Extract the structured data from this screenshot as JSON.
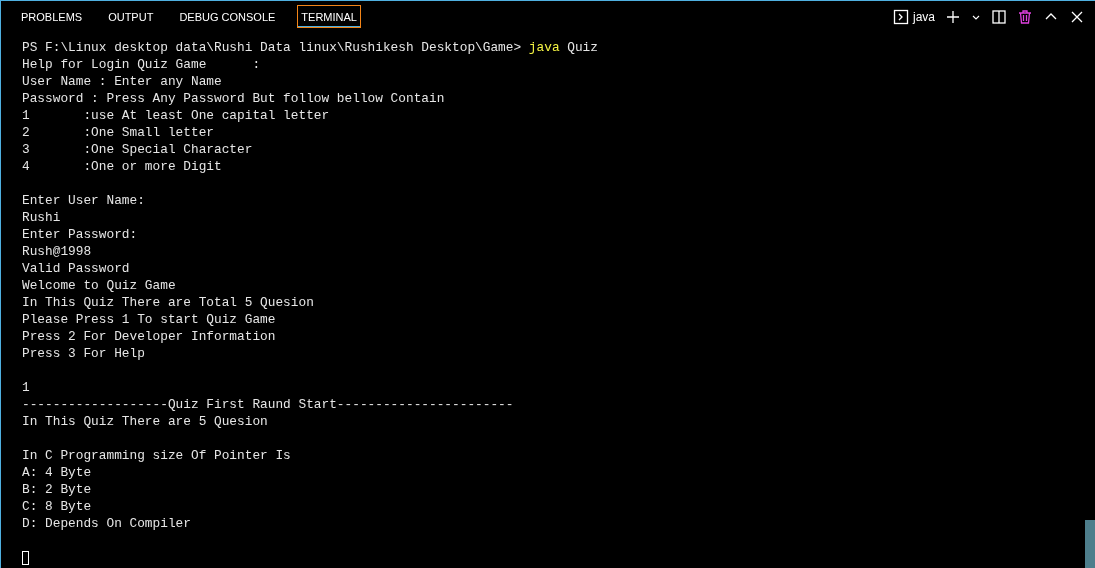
{
  "tabs": [
    {
      "label": "PROBLEMS",
      "selected": false
    },
    {
      "label": "OUTPUT",
      "selected": false
    },
    {
      "label": "DEBUG CONSOLE",
      "selected": false
    },
    {
      "label": "TERMINAL",
      "selected": true
    }
  ],
  "terminal_picker": {
    "label": "java"
  },
  "lines": [
    {
      "kind": "command",
      "prompt": "PS F:\\Linux desktop data\\Rushi Data linux\\Rushikesh Desktop\\Game>",
      "command": "java",
      "args": "Quiz"
    },
    {
      "kind": "text",
      "text": "Help for Login Quiz Game      :"
    },
    {
      "kind": "text",
      "text": "User Name : Enter any Name"
    },
    {
      "kind": "text",
      "text": "Password : Press Any Password But follow bellow Contain"
    },
    {
      "kind": "text",
      "text": "1       :use At least One capital letter"
    },
    {
      "kind": "text",
      "text": "2       :One Small letter"
    },
    {
      "kind": "text",
      "text": "3       :One Special Character"
    },
    {
      "kind": "text",
      "text": "4       :One or more Digit"
    },
    {
      "kind": "blank"
    },
    {
      "kind": "text",
      "text": "Enter User Name:"
    },
    {
      "kind": "text",
      "text": "Rushi"
    },
    {
      "kind": "text",
      "text": "Enter Password:"
    },
    {
      "kind": "text",
      "text": "Rush@1998"
    },
    {
      "kind": "text",
      "text": "Valid Password"
    },
    {
      "kind": "text",
      "text": "Welcome to Quiz Game"
    },
    {
      "kind": "text",
      "text": "In This Quiz There are Total 5 Quesion"
    },
    {
      "kind": "text",
      "text": "Please Press 1 To start Quiz Game"
    },
    {
      "kind": "text",
      "text": "Press 2 For Developer Information"
    },
    {
      "kind": "text",
      "text": "Press 3 For Help"
    },
    {
      "kind": "blank"
    },
    {
      "kind": "text",
      "text": "1"
    },
    {
      "kind": "text",
      "text": "-------------------Quiz First Raund Start-----------------------"
    },
    {
      "kind": "text",
      "text": "In This Quiz There are 5 Quesion"
    },
    {
      "kind": "blank"
    },
    {
      "kind": "text",
      "text": "In C Programming size Of Pointer Is"
    },
    {
      "kind": "text",
      "text": "A: 4 Byte"
    },
    {
      "kind": "text",
      "text": "B: 2 Byte"
    },
    {
      "kind": "text",
      "text": "C: 8 Byte"
    },
    {
      "kind": "text",
      "text": "D: Depends On Compiler"
    },
    {
      "kind": "blank"
    },
    {
      "kind": "cursor"
    }
  ]
}
